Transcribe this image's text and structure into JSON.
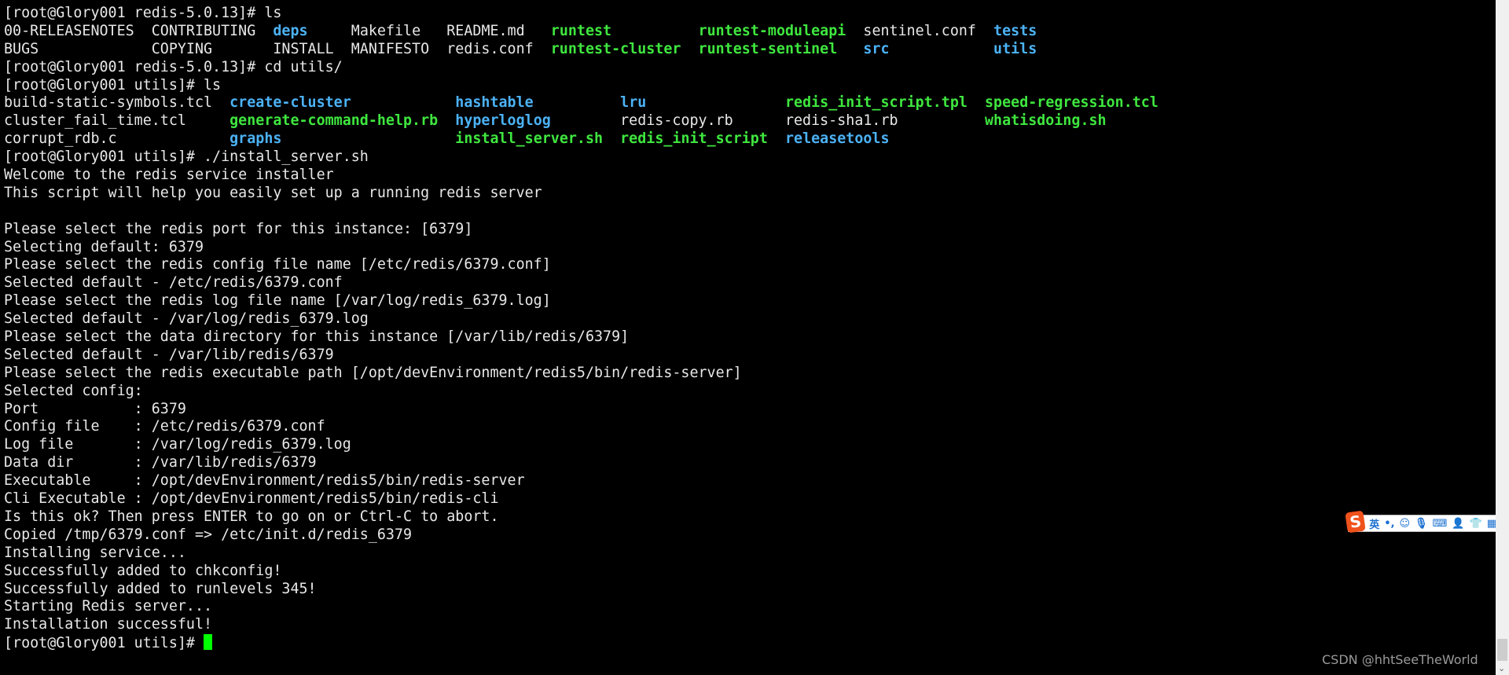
{
  "terminal": {
    "lines": [
      [
        [
          "[root@Glory001 redis-5.0.13]# ls",
          "w"
        ]
      ],
      [
        [
          "00-RELEASENOTES  CONTRIBUTING  ",
          "w"
        ],
        [
          "deps",
          "b"
        ],
        [
          "     Makefile   README.md   ",
          "w"
        ],
        [
          "runtest",
          "g"
        ],
        [
          "          ",
          "w"
        ],
        [
          "runtest-moduleapi",
          "g"
        ],
        [
          "  sentinel.conf  ",
          "w"
        ],
        [
          "tests",
          "b"
        ]
      ],
      [
        [
          "BUGS             COPYING       INSTALL  MANIFESTO  redis.conf  ",
          "w"
        ],
        [
          "runtest-cluster",
          "g"
        ],
        [
          "  ",
          "w"
        ],
        [
          "runtest-sentinel",
          "g"
        ],
        [
          "   ",
          "w"
        ],
        [
          "src",
          "b"
        ],
        [
          "            ",
          "w"
        ],
        [
          "utils",
          "b"
        ]
      ],
      [
        [
          "[root@Glory001 redis-5.0.13]# cd utils/",
          "w"
        ]
      ],
      [
        [
          "[root@Glory001 utils]# ls",
          "w"
        ]
      ],
      [
        [
          "build-static-symbols.tcl  ",
          "w"
        ],
        [
          "create-cluster",
          "b"
        ],
        [
          "            ",
          "w"
        ],
        [
          "hashtable",
          "b"
        ],
        [
          "          ",
          "w"
        ],
        [
          "lru",
          "b"
        ],
        [
          "                ",
          "w"
        ],
        [
          "redis_init_script.tpl",
          "g"
        ],
        [
          "  ",
          "w"
        ],
        [
          "speed-regression.tcl",
          "g"
        ]
      ],
      [
        [
          "cluster_fail_time.tcl     ",
          "w"
        ],
        [
          "generate-command-help.rb",
          "g"
        ],
        [
          "  ",
          "w"
        ],
        [
          "hyperloglog",
          "b"
        ],
        [
          "        redis-copy.rb      redis-sha1.rb          ",
          "w"
        ],
        [
          "whatisdoing.sh",
          "g"
        ]
      ],
      [
        [
          "corrupt_rdb.c             ",
          "w"
        ],
        [
          "graphs",
          "b"
        ],
        [
          "                    ",
          "w"
        ],
        [
          "install_server.sh",
          "g"
        ],
        [
          "  ",
          "w"
        ],
        [
          "redis_init_script",
          "g"
        ],
        [
          "  ",
          "w"
        ],
        [
          "releasetools",
          "b"
        ]
      ],
      [
        [
          "[root@Glory001 utils]# ./install_server.sh",
          "w"
        ]
      ],
      [
        [
          "Welcome to the redis service installer",
          "w"
        ]
      ],
      [
        [
          "This script will help you easily set up a running redis server",
          "w"
        ]
      ],
      [
        [
          "",
          "w"
        ]
      ],
      [
        [
          "Please select the redis port for this instance: [6379]",
          "w"
        ]
      ],
      [
        [
          "Selecting default: 6379",
          "w"
        ]
      ],
      [
        [
          "Please select the redis config file name [/etc/redis/6379.conf]",
          "w"
        ]
      ],
      [
        [
          "Selected default - /etc/redis/6379.conf",
          "w"
        ]
      ],
      [
        [
          "Please select the redis log file name [/var/log/redis_6379.log]",
          "w"
        ]
      ],
      [
        [
          "Selected default - /var/log/redis_6379.log",
          "w"
        ]
      ],
      [
        [
          "Please select the data directory for this instance [/var/lib/redis/6379]",
          "w"
        ]
      ],
      [
        [
          "Selected default - /var/lib/redis/6379",
          "w"
        ]
      ],
      [
        [
          "Please select the redis executable path [/opt/devEnvironment/redis5/bin/redis-server]",
          "w"
        ]
      ],
      [
        [
          "Selected config:",
          "w"
        ]
      ],
      [
        [
          "Port           : 6379",
          "w"
        ]
      ],
      [
        [
          "Config file    : /etc/redis/6379.conf",
          "w"
        ]
      ],
      [
        [
          "Log file       : /var/log/redis_6379.log",
          "w"
        ]
      ],
      [
        [
          "Data dir       : /var/lib/redis/6379",
          "w"
        ]
      ],
      [
        [
          "Executable     : /opt/devEnvironment/redis5/bin/redis-server",
          "w"
        ]
      ],
      [
        [
          "Cli Executable : /opt/devEnvironment/redis5/bin/redis-cli",
          "w"
        ]
      ],
      [
        [
          "Is this ok? Then press ENTER to go on or Ctrl-C to abort.",
          "w"
        ]
      ],
      [
        [
          "Copied /tmp/6379.conf => /etc/init.d/redis_6379",
          "w"
        ]
      ],
      [
        [
          "Installing service...",
          "w"
        ]
      ],
      [
        [
          "Successfully added to chkconfig!",
          "w"
        ]
      ],
      [
        [
          "Successfully added to runlevels 345!",
          "w"
        ]
      ],
      [
        [
          "Starting Redis server...",
          "w"
        ]
      ],
      [
        [
          "Installation successful!",
          "w"
        ]
      ],
      [
        [
          "[root@Glory001 utils]# ",
          "w"
        ]
      ]
    ],
    "colors": {
      "directory": "#4cb2f5",
      "executable": "#3fe63f",
      "text": "#e8e8e8",
      "cursor": "#00ff00"
    }
  },
  "ime_toolbar": {
    "logo": "S",
    "mode": "英",
    "punct": "•,",
    "icons": [
      "emoji-icon",
      "microphone-icon",
      "keyboard-icon",
      "user-icon",
      "skin-shirt-icon",
      "grid-menu-icon"
    ]
  },
  "watermark": "CSDN @hhtSeeTheWorld"
}
